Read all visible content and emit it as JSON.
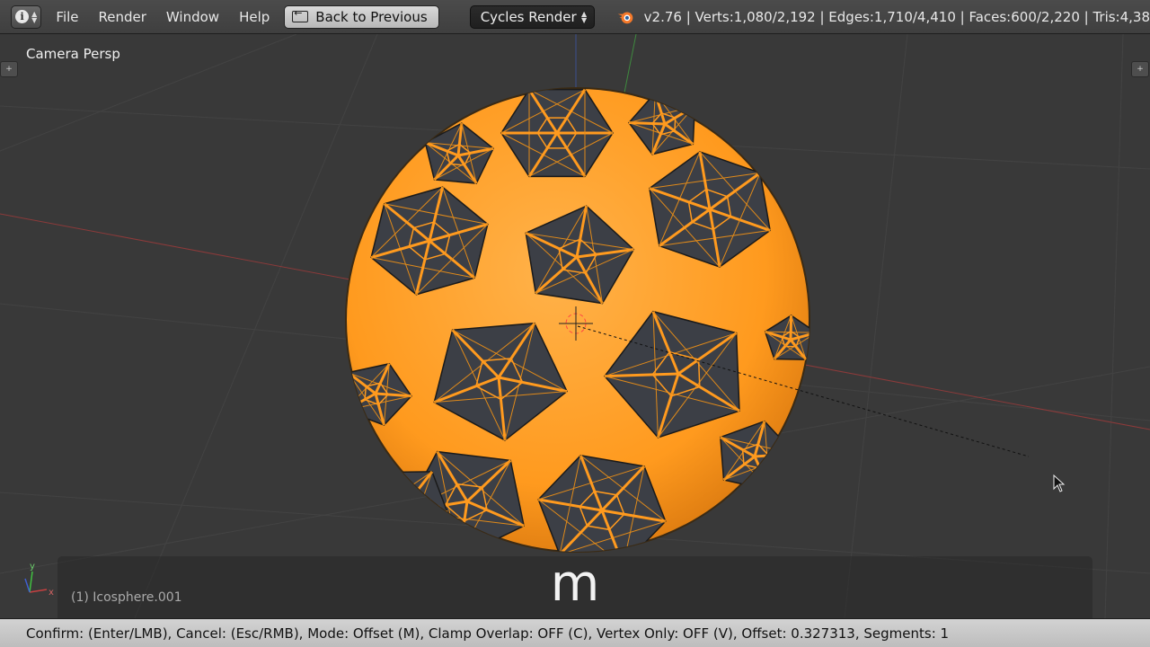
{
  "header": {
    "editor_type_icon": "info-icon",
    "menu": [
      "File",
      "Render",
      "Window",
      "Help"
    ],
    "back_button": "Back to Previous",
    "render_engine": "Cycles Render",
    "logo_icon": "blender-logo",
    "stats": "v2.76 | Verts:1,080/2,192 | Edges:1,710/4,410 | Faces:600/2,220 | Tris:4,38"
  },
  "viewport": {
    "view_name": "Camera Persp",
    "object_name": "(1) Icosphere.001",
    "key_pressed": "m",
    "axis_labels": {
      "x": "x",
      "y": "y"
    },
    "selection_color": "#ff9a1e"
  },
  "status_bar": {
    "text": "Confirm: (Enter/LMB), Cancel: (Esc/RMB), Mode: Offset (M), Clamp Overlap: OFF (C), Vertex Only: OFF (V), Offset: 0.327313, Segments: 1"
  }
}
